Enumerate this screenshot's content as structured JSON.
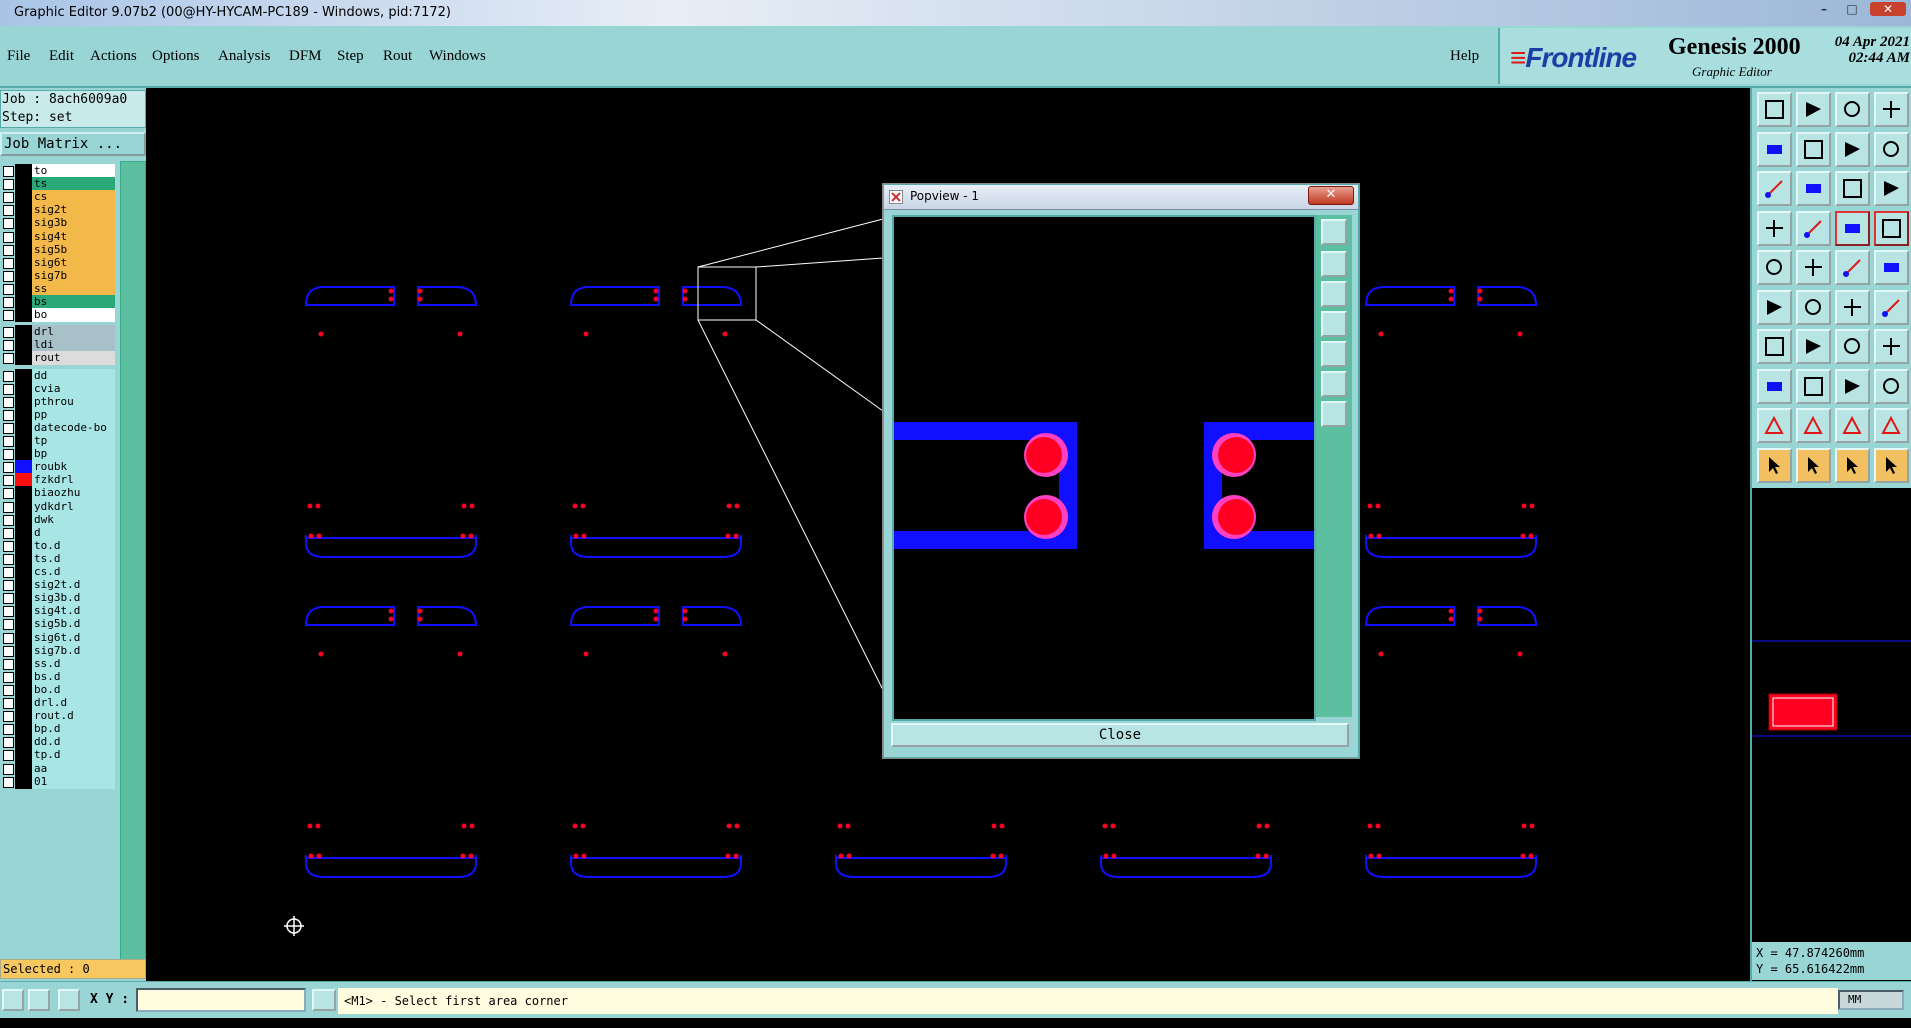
{
  "window": {
    "title": "Graphic Editor 9.07b2 (00@HY-HYCAM-PC189 - Windows, pid:7172)"
  },
  "menu": {
    "items": [
      "File",
      "Edit",
      "Actions",
      "Options",
      "Analysis",
      "DFM",
      "Step",
      "Rout",
      "Windows"
    ],
    "help": "Help"
  },
  "brand": {
    "logo": "Frontline",
    "product": "Genesis 2000",
    "subtitle": "Graphic Editor",
    "date": "04 Apr 2021",
    "time": "02:44 AM"
  },
  "job": {
    "job_line": "Job : 8ach6009a0",
    "step_line": "Step: set",
    "matrix_button": "Job Matrix ..."
  },
  "layers": [
    {
      "name": "to",
      "bg": "#ffffff",
      "color": "#000000"
    },
    {
      "name": "ts",
      "bg": "#2aa878",
      "color": "#000000"
    },
    {
      "name": "cs",
      "bg": "#f2b84a",
      "color": "#000000"
    },
    {
      "name": "sig2t",
      "bg": "#f2b84a",
      "color": "#000000"
    },
    {
      "name": "sig3b",
      "bg": "#f2b84a",
      "color": "#000000"
    },
    {
      "name": "sig4t",
      "bg": "#f2b84a",
      "color": "#000000"
    },
    {
      "name": "sig5b",
      "bg": "#f2b84a",
      "color": "#000000"
    },
    {
      "name": "sig6t",
      "bg": "#f2b84a",
      "color": "#000000"
    },
    {
      "name": "sig7b",
      "bg": "#f2b84a",
      "color": "#000000"
    },
    {
      "name": "ss",
      "bg": "#f2b84a",
      "color": "#000000"
    },
    {
      "name": "bs",
      "bg": "#2aa878",
      "color": "#000000"
    },
    {
      "name": "bo",
      "bg": "#ffffff",
      "color": "#000000"
    },
    {
      "name": "drl",
      "bg": "#a8c0c8",
      "color": "#000000"
    },
    {
      "name": "ldi",
      "bg": "#a8c0c8",
      "color": "#000000"
    },
    {
      "name": "rout",
      "bg": "#dcdcdc",
      "color": "#000000"
    },
    {
      "name": "dd",
      "bg": "#a8e6e6",
      "color": "#000000"
    },
    {
      "name": "cvia",
      "bg": "#a8e6e6",
      "color": "#000000"
    },
    {
      "name": "pthrou",
      "bg": "#a8e6e6",
      "color": "#000000"
    },
    {
      "name": "pp",
      "bg": "#a8e6e6",
      "color": "#000000"
    },
    {
      "name": "datecode-bo",
      "bg": "#a8e6e6",
      "color": "#000000"
    },
    {
      "name": "tp",
      "bg": "#a8e6e6",
      "color": "#000000"
    },
    {
      "name": "bp",
      "bg": "#a8e6e6",
      "color": "#000000"
    },
    {
      "name": "roubk",
      "bg": "#a8e6e6",
      "color": "#1010ff"
    },
    {
      "name": "fzkdrl",
      "bg": "#a8e6e6",
      "color": "#ff1010"
    },
    {
      "name": "biaozhu",
      "bg": "#a8e6e6",
      "color": "#000000"
    },
    {
      "name": "ydkdrl",
      "bg": "#a8e6e6",
      "color": "#000000"
    },
    {
      "name": "dwk",
      "bg": "#a8e6e6",
      "color": "#000000"
    },
    {
      "name": "d",
      "bg": "#a8e6e6",
      "color": "#000000"
    },
    {
      "name": "to.d",
      "bg": "#a8e6e6",
      "color": "#000000"
    },
    {
      "name": "ts.d",
      "bg": "#a8e6e6",
      "color": "#000000"
    },
    {
      "name": "cs.d",
      "bg": "#a8e6e6",
      "color": "#000000"
    },
    {
      "name": "sig2t.d",
      "bg": "#a8e6e6",
      "color": "#000000"
    },
    {
      "name": "sig3b.d",
      "bg": "#a8e6e6",
      "color": "#000000"
    },
    {
      "name": "sig4t.d",
      "bg": "#a8e6e6",
      "color": "#000000"
    },
    {
      "name": "sig5b.d",
      "bg": "#a8e6e6",
      "color": "#000000"
    },
    {
      "name": "sig6t.d",
      "bg": "#a8e6e6",
      "color": "#000000"
    },
    {
      "name": "sig7b.d",
      "bg": "#a8e6e6",
      "color": "#000000"
    },
    {
      "name": "ss.d",
      "bg": "#a8e6e6",
      "color": "#000000"
    },
    {
      "name": "bs.d",
      "bg": "#a8e6e6",
      "color": "#000000"
    },
    {
      "name": "bo.d",
      "bg": "#a8e6e6",
      "color": "#000000"
    },
    {
      "name": "drl.d",
      "bg": "#a8e6e6",
      "color": "#000000"
    },
    {
      "name": "rout.d",
      "bg": "#a8e6e6",
      "color": "#000000"
    },
    {
      "name": "bp.d",
      "bg": "#a8e6e6",
      "color": "#000000"
    },
    {
      "name": "dd.d",
      "bg": "#a8e6e6",
      "color": "#000000"
    },
    {
      "name": "tp.d",
      "bg": "#a8e6e6",
      "color": "#000000"
    },
    {
      "name": "aa",
      "bg": "#a8e6e6",
      "color": "#000000"
    },
    {
      "name": "01",
      "bg": "#a8e6e6",
      "color": "#000000"
    }
  ],
  "selected": "Selected : 0",
  "popview": {
    "title": "Popview - 1",
    "close_label": "Close"
  },
  "coords": {
    "x": "X = 47.874260mm",
    "y": "Y = 65.616422mm"
  },
  "bottom": {
    "xy_label": "X Y :",
    "xy_value": "",
    "status": "<M1> - Select first area corner",
    "units": "MM"
  },
  "colors": {
    "panel": "#99d5d5",
    "outline": "#1010ff",
    "pad": "#ff0022",
    "pad_mask": "#ff40c0"
  }
}
